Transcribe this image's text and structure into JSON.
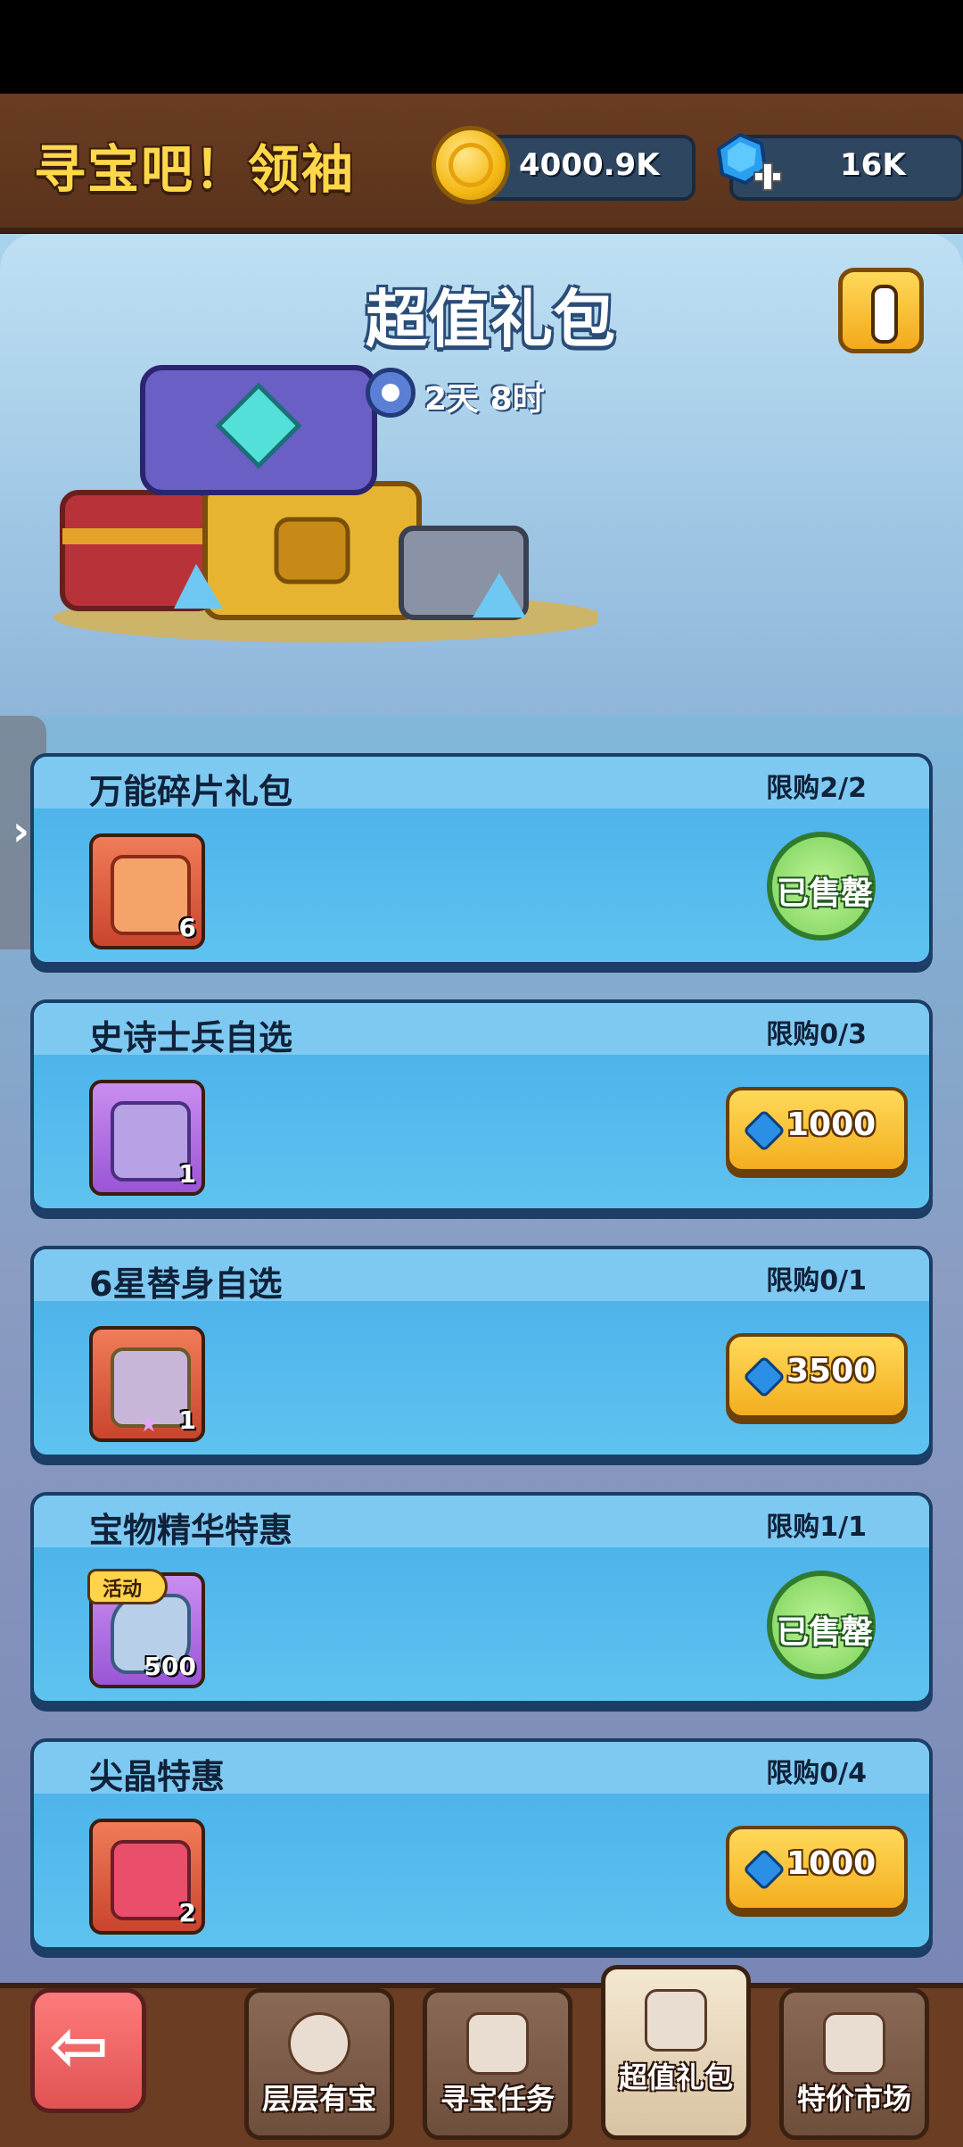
{
  "header": {
    "title": "寻宝吧！领袖",
    "coins": "4000.9K",
    "gems": "16K"
  },
  "hero": {
    "title": "超值礼包",
    "timer": "2天 8时"
  },
  "offers": [
    {
      "name": "万能碎片礼包",
      "limit": "限购2/2",
      "count": "6",
      "status": "已售罄"
    },
    {
      "name": "史诗士兵自选",
      "limit": "限购0/3",
      "count": "1",
      "price": "1000"
    },
    {
      "name": "6星替身自选",
      "limit": "限购0/1",
      "count": "1",
      "price": "3500"
    },
    {
      "name": "宝物精华特惠",
      "limit": "限购1/1",
      "count": "500",
      "badge": "活动",
      "status": "已售罄"
    },
    {
      "name": "尖晶特惠",
      "limit": "限购0/4",
      "count": "2",
      "price": "1000"
    }
  ],
  "nav": {
    "tabs": [
      "层层有宝",
      "寻宝任务",
      "超值礼包",
      "特价市场"
    ]
  }
}
